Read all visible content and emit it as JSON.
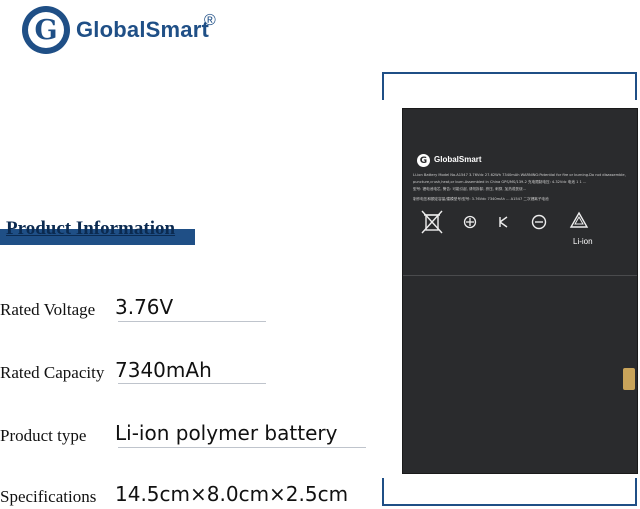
{
  "brand": {
    "name": "GlobalSmart",
    "registered_mark": "®",
    "logo_letter": "G"
  },
  "section_title": "Product Information",
  "specs": [
    {
      "label": "Rated Voltage",
      "value": "3.76V"
    },
    {
      "label": "Rated Capacity",
      "value": "7340mAh"
    },
    {
      "label": "Product type",
      "value": "Li-ion polymer battery"
    },
    {
      "label": "Specifications",
      "value": "14.5cm×8.0cm×2.5cm"
    }
  ],
  "battery_label": {
    "brand": "GlobalSmart",
    "logo_letter": "G",
    "line1": "Li-ion Battery Model No.A1547  3.76Vdc  27.62Wh  7340mAh  WARNING:Potential for fire or burning.Do not disassemble,",
    "line2": "puncture,crush,heat,or burn.Assembled in China  GPS/MS/139-2  充电限制电压: 4.32Vdc 电池 1 1 ...",
    "line3": "型号: 锂电池电芯, 警告: 可能引起, 请勿拆卸, 挤压, 刺穿, 加热或焚烧...",
    "line4": "制作电压和额定容量/建模型号/型号: 3.76Vdc  7340mAh  ...  A1547  二次锂离子电池",
    "recycle_label": "Li-ion"
  }
}
